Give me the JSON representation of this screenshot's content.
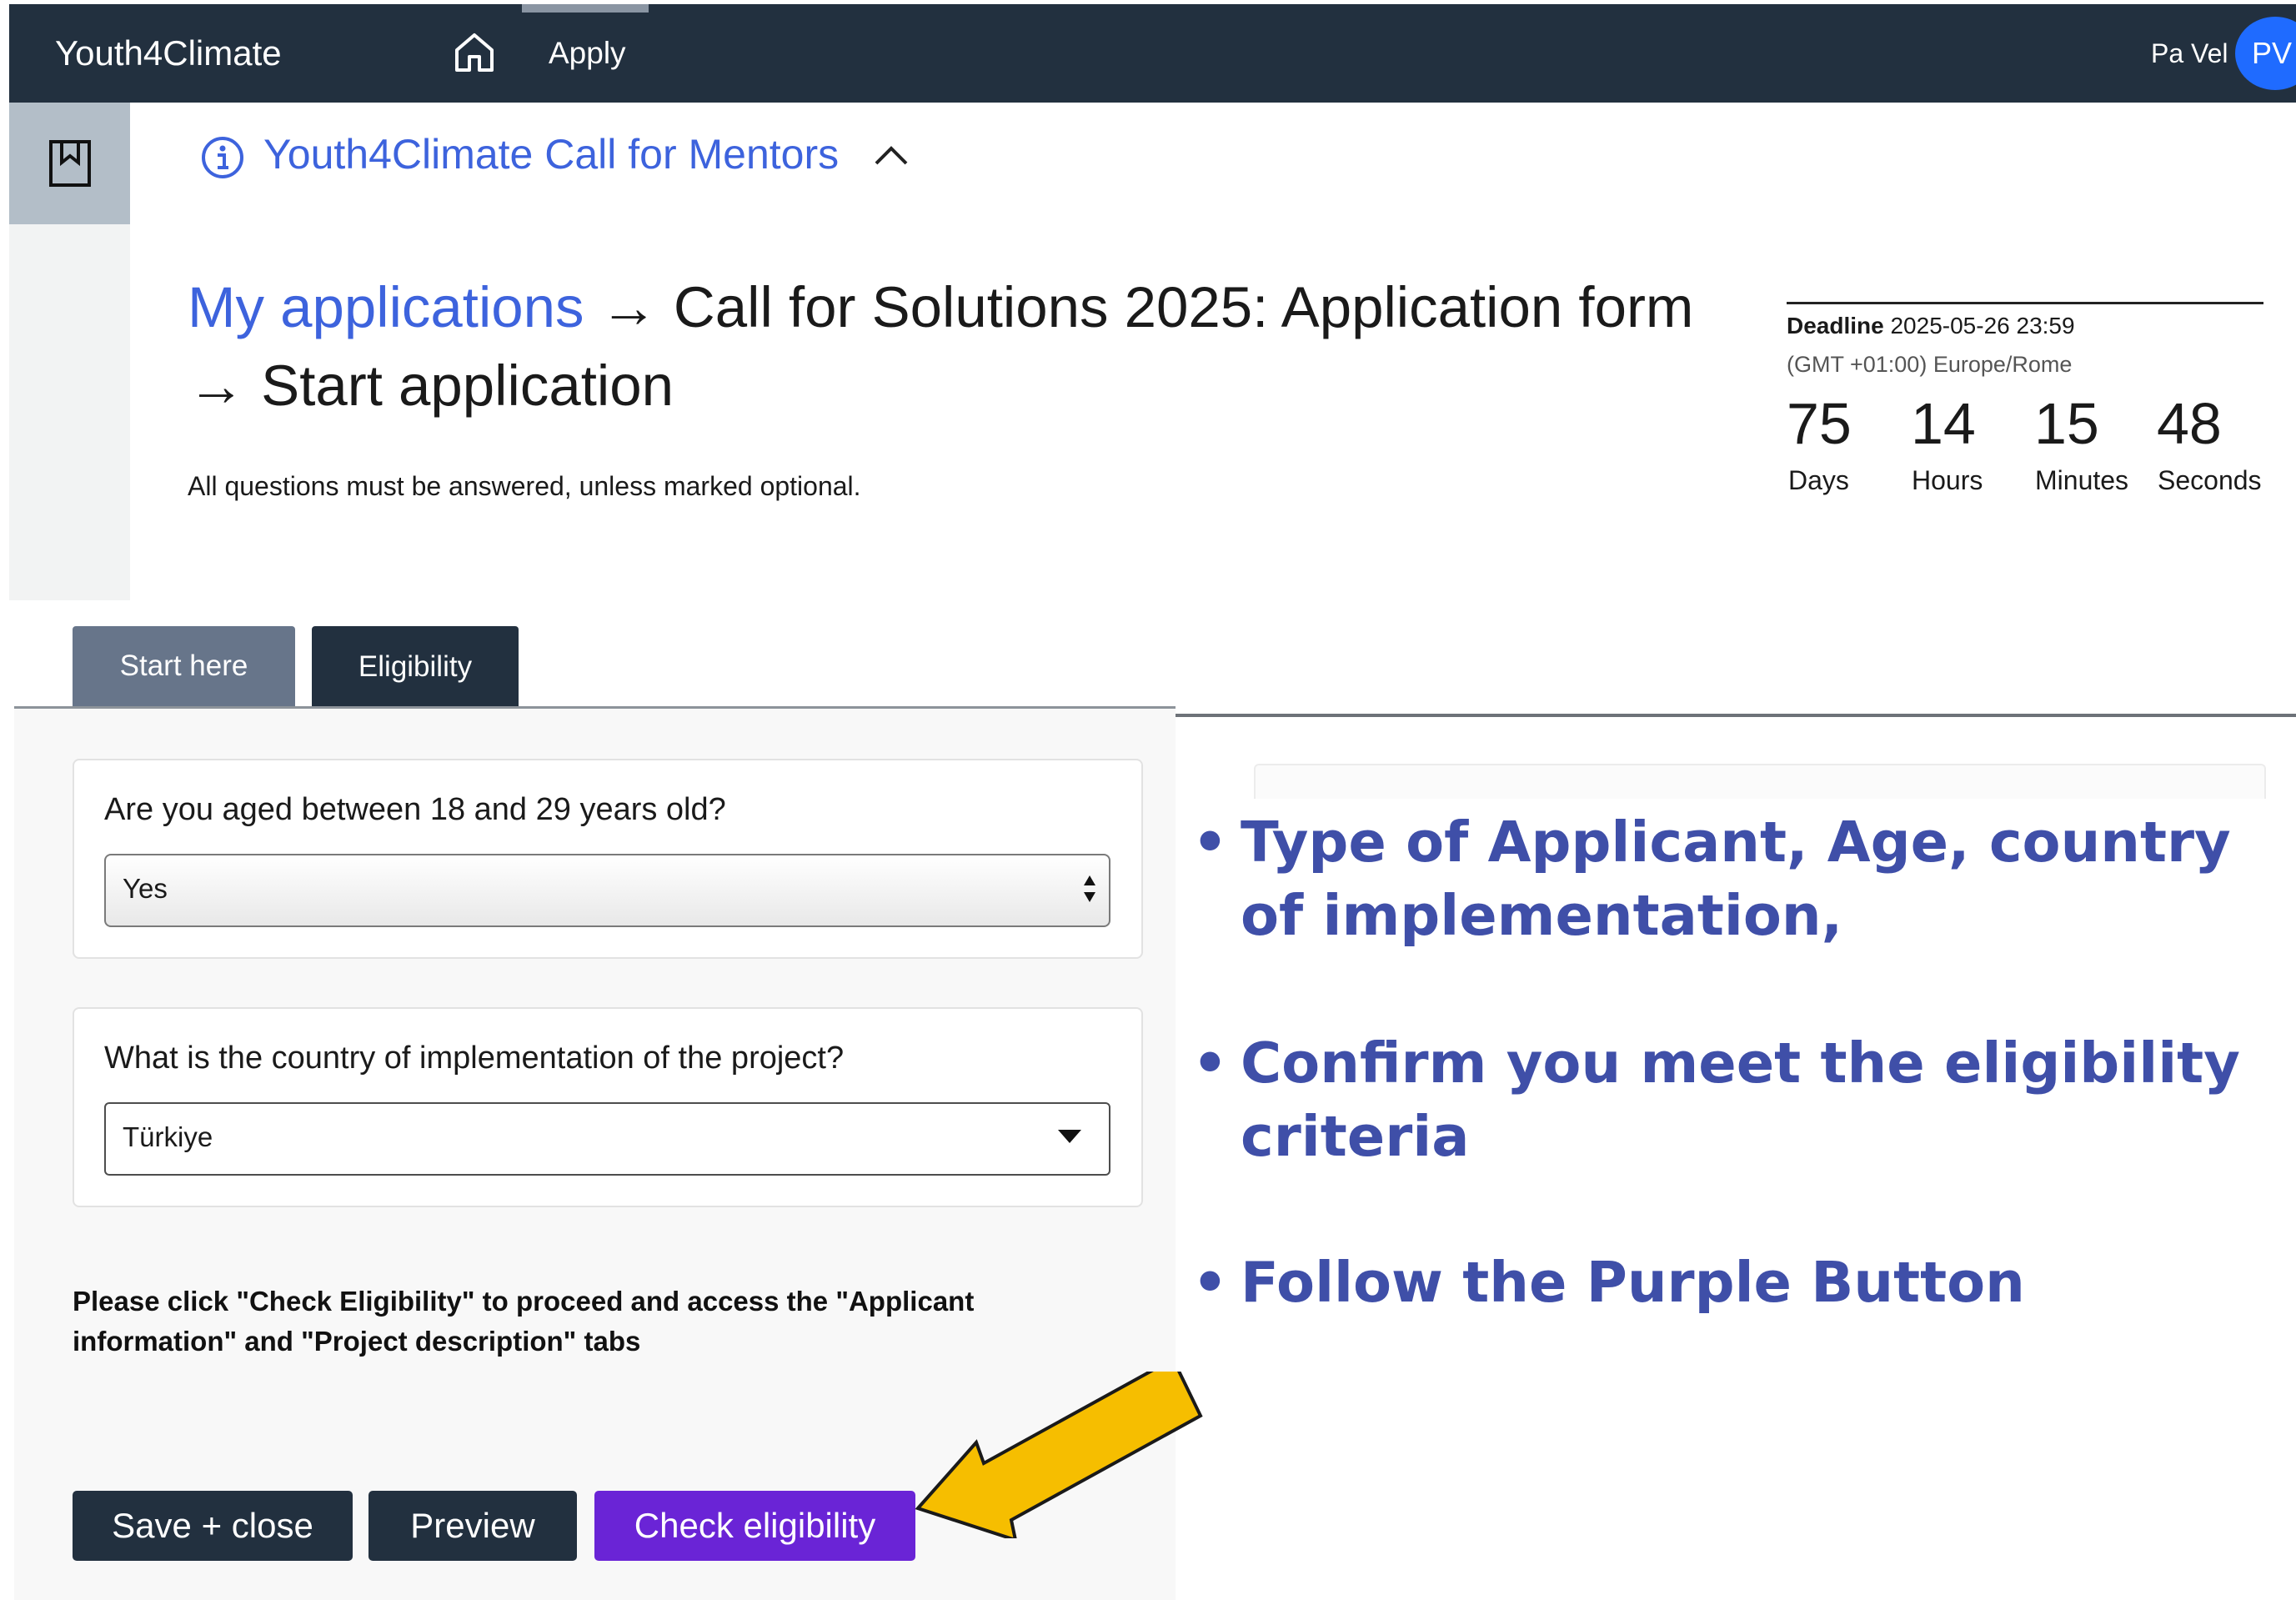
{
  "topbar": {
    "brand": "Youth4Climate",
    "apply_label": "Apply",
    "user_name": "Pa Vel",
    "avatar_initials": "PV",
    "background": "#22303f"
  },
  "sidebar": {
    "bookmark_icon": "bookmark-icon"
  },
  "call": {
    "title": "Youth4Climate Call for Mentors"
  },
  "breadcrumb": {
    "link": "My applications",
    "sep1": "→",
    "form": "Call for Solutions 2025: Application form",
    "sep2": "→",
    "current": "Start application"
  },
  "instruction": "All questions must be answered, unless marked optional.",
  "deadline": {
    "label": "Deadline",
    "datetime": "2025-05-26 23:59",
    "timezone": "(GMT +01:00) Europe/Rome",
    "days": "75",
    "days_label": "Days",
    "hours": "14",
    "hours_label": "Hours",
    "minutes": "15",
    "minutes_label": "Minutes",
    "seconds": "48",
    "seconds_label": "Seconds"
  },
  "tabs": [
    {
      "label": "Start here"
    },
    {
      "label": "Eligibility"
    }
  ],
  "questions": [
    {
      "label": "Are you aged between 18 and 29 years old?",
      "value": "Yes"
    },
    {
      "label": "What is the country of implementation of the project?",
      "value": "Türkiye"
    }
  ],
  "notice": "Please click \"Check Eligibility\" to proceed and access the \"Applicant information\" and \"Project description\" tabs",
  "buttons": {
    "save": "Save + close",
    "preview": "Preview",
    "check": "Check eligibility"
  },
  "annotations": [
    "Type of Applicant, Age, country of implementation,",
    "Confirm you meet the eligibility criteria",
    "Follow the Purple Button"
  ],
  "bullet_symbol": "•",
  "colors": {
    "link_blue": "#3d63dd",
    "check_button_purple": "#6a24d6",
    "annotation_blue": "#3f4fa8",
    "arrow_yellow": "#f6be00"
  }
}
